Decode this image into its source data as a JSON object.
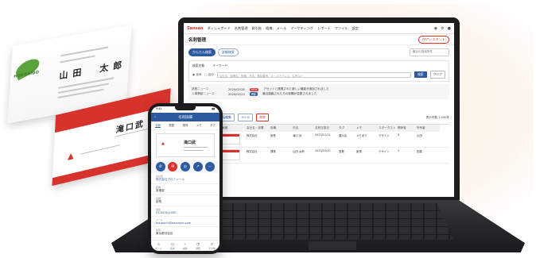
{
  "cards": {
    "back_company_logo": "HOKKAIDO",
    "back_name": "山田　太郎",
    "front_name": "滝口武"
  },
  "laptop": {
    "brand": "Sansan",
    "nav": [
      "ダッシュボード",
      "名刺管理",
      "取引先",
      "組織",
      "メール",
      "マーケティング",
      "レポート",
      "ファイル",
      "設定"
    ],
    "page_title": "名刺管理",
    "ai_button": "AIアシスタント",
    "tabs": [
      "かんたん検索",
      "詳細検索"
    ],
    "recent_placeholder": "最近の検索条件",
    "search": {
      "target_label": "検索対象",
      "keyword_label": "キーワード",
      "radio_all": "全体",
      "radio_mine": "自分",
      "keyword_placeholder": "会社名、部署名、役職、氏名、電話番号、メールアドレス、住所など",
      "search_button": "検索",
      "clear_button": "クリア"
    },
    "notices": [
      {
        "label": "新着ニュース",
        "date": "2024/02/28",
        "badge": "NEW",
        "text": "アセットと連携された新しい機能が追加されました"
      },
      {
        "label": "人事異動ニュース",
        "date": "2024/02/23",
        "badge": "異動",
        "text": "最近接触された方の役職が変更されました"
      }
    ],
    "list_tab": "オンライン名刺交換",
    "toolbar": {
      "export": "エクスポート",
      "bulk_edit": "一括編集",
      "mail": "メール",
      "delete": "削除",
      "count": "表示件数 1,000件"
    },
    "columns": [
      "",
      "日付",
      "名刺画像",
      "会社名・部署",
      "役職",
      "氏名",
      "名刺交換日",
      "タグ",
      "メモ",
      "スターダスト",
      "関係者",
      "所有者"
    ],
    "rows": [
      {
        "date": "2024/02",
        "company": "株式会社",
        "title": "部長",
        "name": "滝口 武",
        "exchanged": "2023/11/11",
        "tag": "展示会",
        "memo": "メモあり",
        "star": "デザイン",
        "related": "3",
        "owner": "山田"
      },
      {
        "date": "2024/02",
        "company": "株式会社",
        "title": "課長",
        "name": "山田 太郎",
        "exchanged": "2023/10/10",
        "tag": "営業",
        "memo": "新規",
        "star": "デザイン",
        "related": "2",
        "owner": "佐藤"
      }
    ]
  },
  "phone": {
    "time": "9:41",
    "header_title": "名刺詳細",
    "tabs": [
      "名刺",
      "履歴",
      "関係",
      "メモ",
      "タグ"
    ],
    "card_name": "滝口武",
    "fields": [
      {
        "label": "会社名",
        "value": "株式会社プロフィール"
      },
      {
        "label": "部署",
        "value": "営業部"
      },
      {
        "label": "役職",
        "value": "部長"
      },
      {
        "label": "電話",
        "value": "03-0000-0000"
      },
      {
        "label": "メール",
        "value": "takiguchi@example.com"
      },
      {
        "label": "住所",
        "value": "東京都渋谷区"
      }
    ],
    "nav": [
      "ホーム",
      "名刺",
      "検索",
      "通知",
      "その他"
    ]
  },
  "colors": {
    "accent": "#d8322d",
    "primary": "#2b5a9e"
  }
}
